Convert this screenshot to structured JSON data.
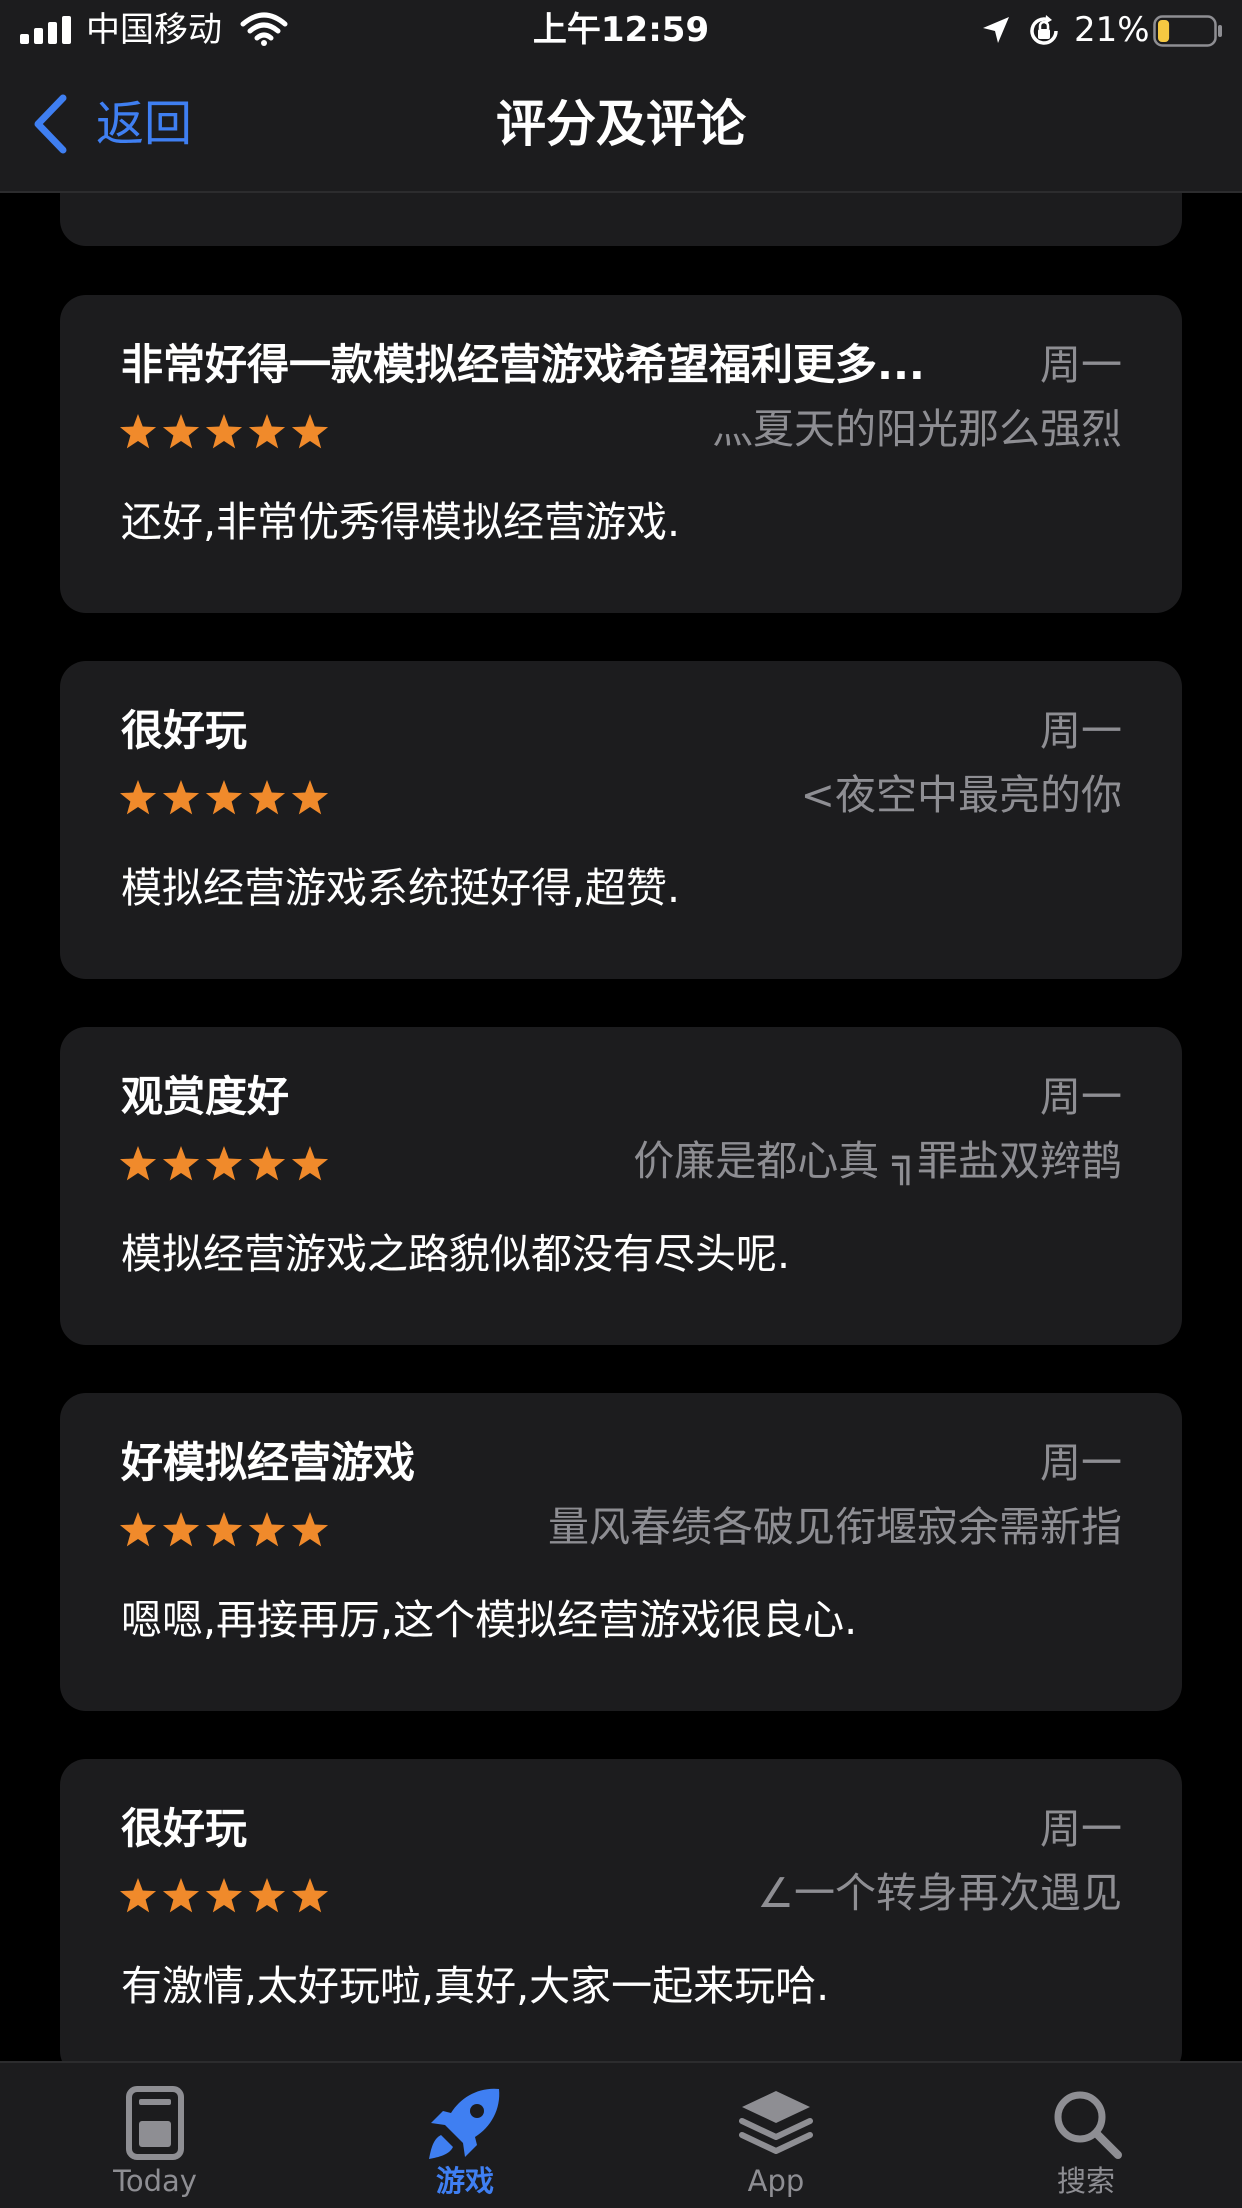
{
  "status_bar": {
    "carrier": "中国移动",
    "time": "上午12:59",
    "battery_percent": "21%",
    "battery_level": 0.21,
    "icons": [
      "signal-icon",
      "wifi-icon",
      "location-arrow-icon",
      "orientation-lock-icon",
      "battery-icon"
    ]
  },
  "nav": {
    "back_label": "返回",
    "title": "评分及评论"
  },
  "reviews": [
    {
      "title": "非常好得一款模拟经营游戏希望福利更多...",
      "date": "周一",
      "rating": 5,
      "author": "灬夏天的阳光那么强烈",
      "body": "还好,非常优秀得模拟经营游戏."
    },
    {
      "title": "很好玩",
      "date": "周一",
      "rating": 5,
      "author": "<夜空中最亮的你",
      "body": "模拟经营游戏系统挺好得,超赞."
    },
    {
      "title": "观赏度好",
      "date": "周一",
      "rating": 5,
      "author": "价廉是都心真 ╗罪盐双辫鹊",
      "body": "模拟经营游戏之路貌似都没有尽头呢."
    },
    {
      "title": "好模拟经营游戏",
      "date": "周一",
      "rating": 5,
      "author": "量风春绩各破见衔堰寂余需新指",
      "body": "嗯嗯,再接再厉,这个模拟经营游戏很良心."
    },
    {
      "title": "很好玩",
      "date": "周一",
      "rating": 5,
      "author": "∠一个转身再次遇见",
      "body": "有激情,太好玩啦,真好,大家一起来玩哈."
    }
  ],
  "tab_bar": {
    "tabs": [
      {
        "label": "Today",
        "icon": "today-icon",
        "active": false
      },
      {
        "label": "游戏",
        "icon": "rocket-icon",
        "active": true
      },
      {
        "label": "App",
        "icon": "app-stack-icon",
        "active": false
      },
      {
        "label": "搜索",
        "icon": "search-icon",
        "active": false
      }
    ]
  },
  "colors": {
    "background": "#000000",
    "card": "#1c1c1e",
    "accent": "#3f7ff2",
    "star": "#f08a2b",
    "secondary_text": "#8e8e93",
    "battery_low": "#f5c842"
  }
}
